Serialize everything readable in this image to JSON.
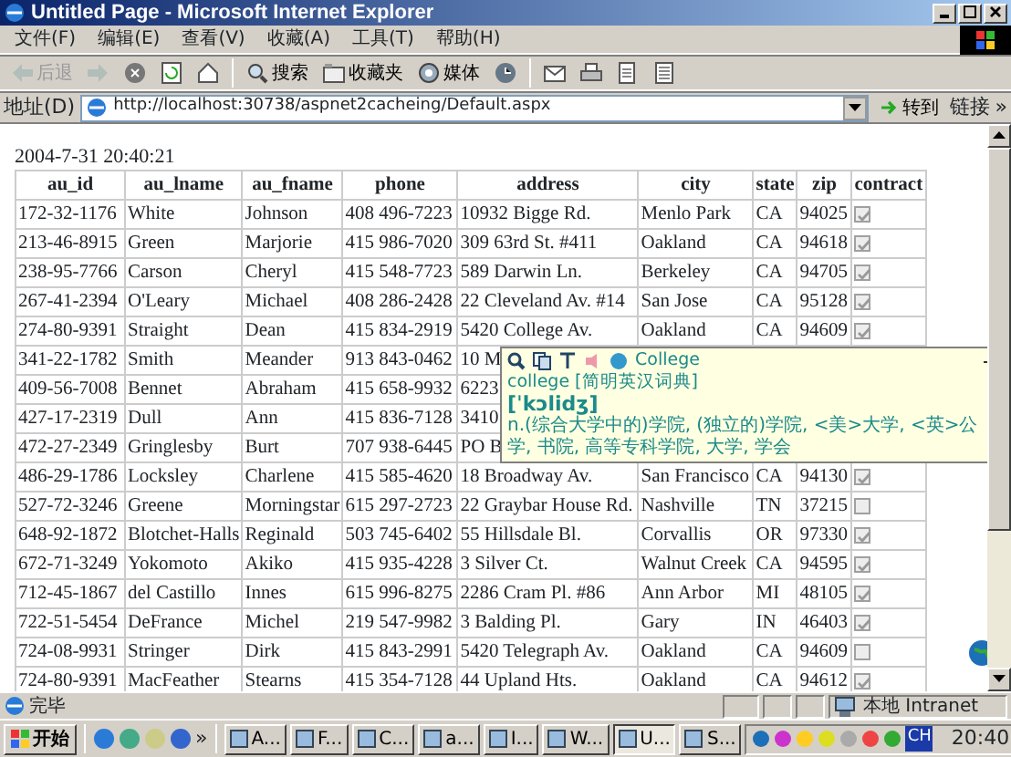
{
  "window": {
    "title": "Untitled Page - Microsoft Internet Explorer"
  },
  "menu": [
    "文件(F)",
    "编辑(E)",
    "查看(V)",
    "收藏(A)",
    "工具(T)",
    "帮助(H)"
  ],
  "toolbar": [
    {
      "kind": "back",
      "label": "后退",
      "disabled": true
    },
    {
      "kind": "forward",
      "disabled": true
    },
    {
      "kind": "stop"
    },
    {
      "kind": "refresh"
    },
    {
      "kind": "home"
    },
    {
      "kind": "search",
      "label": "搜索"
    },
    {
      "kind": "favorites",
      "label": "收藏夹"
    },
    {
      "kind": "media",
      "label": "媒体"
    },
    {
      "kind": "history"
    },
    {
      "kind": "mail"
    },
    {
      "kind": "print"
    },
    {
      "kind": "edit"
    },
    {
      "kind": "discuss"
    }
  ],
  "address_bar": {
    "label": "地址(D)",
    "url": "http://localhost:30738/aspnet2cacheing/Default.aspx",
    "go": "转到",
    "links": "链接",
    "more": "»"
  },
  "timestamp": "2004-7-31 20:40:21",
  "table": {
    "columns": [
      "au_id",
      "au_lname",
      "au_fname",
      "phone",
      "address",
      "city",
      "state",
      "zip",
      "contract"
    ],
    "rows": [
      {
        "au_id": "172-32-1176",
        "au_lname": "White",
        "au_fname": "Johnson",
        "phone": "408 496-7223",
        "address": "10932 Bigge Rd.",
        "city": "Menlo Park",
        "state": "CA",
        "zip": "94025",
        "contract": true
      },
      {
        "au_id": "213-46-8915",
        "au_lname": "Green",
        "au_fname": "Marjorie",
        "phone": "415 986-7020",
        "address": "309 63rd St. #411",
        "city": "Oakland",
        "state": "CA",
        "zip": "94618",
        "contract": true
      },
      {
        "au_id": "238-95-7766",
        "au_lname": "Carson",
        "au_fname": "Cheryl",
        "phone": "415 548-7723",
        "address": "589 Darwin Ln.",
        "city": "Berkeley",
        "state": "CA",
        "zip": "94705",
        "contract": true
      },
      {
        "au_id": "267-41-2394",
        "au_lname": "O'Leary",
        "au_fname": "Michael",
        "phone": "408 286-2428",
        "address": "22 Cleveland Av. #14",
        "city": "San Jose",
        "state": "CA",
        "zip": "95128",
        "contract": true
      },
      {
        "au_id": "274-80-9391",
        "au_lname": "Straight",
        "au_fname": "Dean",
        "phone": "415 834-2919",
        "address": "5420 College Av.",
        "city": "Oakland",
        "state": "CA",
        "zip": "94609",
        "contract": true
      },
      {
        "au_id": "341-22-1782",
        "au_lname": "Smith",
        "au_fname": "Meander",
        "phone": "913 843-0462",
        "address": "10 M"
      },
      {
        "au_id": "409-56-7008",
        "au_lname": "Bennet",
        "au_fname": "Abraham",
        "phone": "415 658-9932",
        "address": "6223"
      },
      {
        "au_id": "427-17-2319",
        "au_lname": "Dull",
        "au_fname": "Ann",
        "phone": "415 836-7128",
        "address": "3410"
      },
      {
        "au_id": "472-27-2349",
        "au_lname": "Gringlesby",
        "au_fname": "Burt",
        "phone": "707 938-6445",
        "address": "PO B"
      },
      {
        "au_id": "486-29-1786",
        "au_lname": "Locksley",
        "au_fname": "Charlene",
        "phone": "415 585-4620",
        "address": "18 Broadway Av.",
        "city": "San Francisco",
        "state": "CA",
        "zip": "94130",
        "contract": true
      },
      {
        "au_id": "527-72-3246",
        "au_lname": "Greene",
        "au_fname": "Morningstar",
        "phone": "615 297-2723",
        "address": "22 Graybar House Rd.",
        "city": "Nashville",
        "state": "TN",
        "zip": "37215",
        "contract": false
      },
      {
        "au_id": "648-92-1872",
        "au_lname": "Blotchet-Halls",
        "au_fname": "Reginald",
        "phone": "503 745-6402",
        "address": "55 Hillsdale Bl.",
        "city": "Corvallis",
        "state": "OR",
        "zip": "97330",
        "contract": true
      },
      {
        "au_id": "672-71-3249",
        "au_lname": "Yokomoto",
        "au_fname": "Akiko",
        "phone": "415 935-4228",
        "address": "3 Silver Ct.",
        "city": "Walnut Creek",
        "state": "CA",
        "zip": "94595",
        "contract": true
      },
      {
        "au_id": "712-45-1867",
        "au_lname": "del Castillo",
        "au_fname": "Innes",
        "phone": "615 996-8275",
        "address": "2286 Cram Pl. #86",
        "city": "Ann Arbor",
        "state": "MI",
        "zip": "48105",
        "contract": true
      },
      {
        "au_id": "722-51-5454",
        "au_lname": "DeFrance",
        "au_fname": "Michel",
        "phone": "219 547-9982",
        "address": "3 Balding Pl.",
        "city": "Gary",
        "state": "IN",
        "zip": "46403",
        "contract": true
      },
      {
        "au_id": "724-08-9931",
        "au_lname": "Stringer",
        "au_fname": "Dirk",
        "phone": "415 843-2991",
        "address": "5420 Telegraph Av.",
        "city": "Oakland",
        "state": "CA",
        "zip": "94609",
        "contract": false
      },
      {
        "au_id": "724-80-9391",
        "au_lname": "MacFeather",
        "au_fname": "Stearns",
        "phone": "415 354-7128",
        "address": "44 Upland Hts.",
        "city": "Oakland",
        "state": "CA",
        "zip": "94612",
        "contract": true
      }
    ]
  },
  "dictionary_popup": {
    "word": "College",
    "entry": "college [简明英汉词典]",
    "phonetic": "[ˈkɔlidʒ]",
    "definition": "n.(综合大学中的)学院, (独立的)学院, <美>大学, <英>公学, 书院, 高等专科学院, 大学, 学会"
  },
  "status_bar": {
    "text": "完毕",
    "zone": "本地 Intranet"
  },
  "taskbar": {
    "start": "开始",
    "more": "»",
    "tasks": [
      {
        "label": "A...",
        "selected": false
      },
      {
        "label": "F...",
        "selected": false
      },
      {
        "label": "C...",
        "selected": false
      },
      {
        "label": "a...",
        "selected": false
      },
      {
        "label": "I...",
        "selected": false
      },
      {
        "label": "W...",
        "selected": false
      },
      {
        "label": "U...",
        "selected": true
      },
      {
        "label": "S...",
        "selected": false
      }
    ],
    "language": "CH",
    "clock": "20:40"
  }
}
